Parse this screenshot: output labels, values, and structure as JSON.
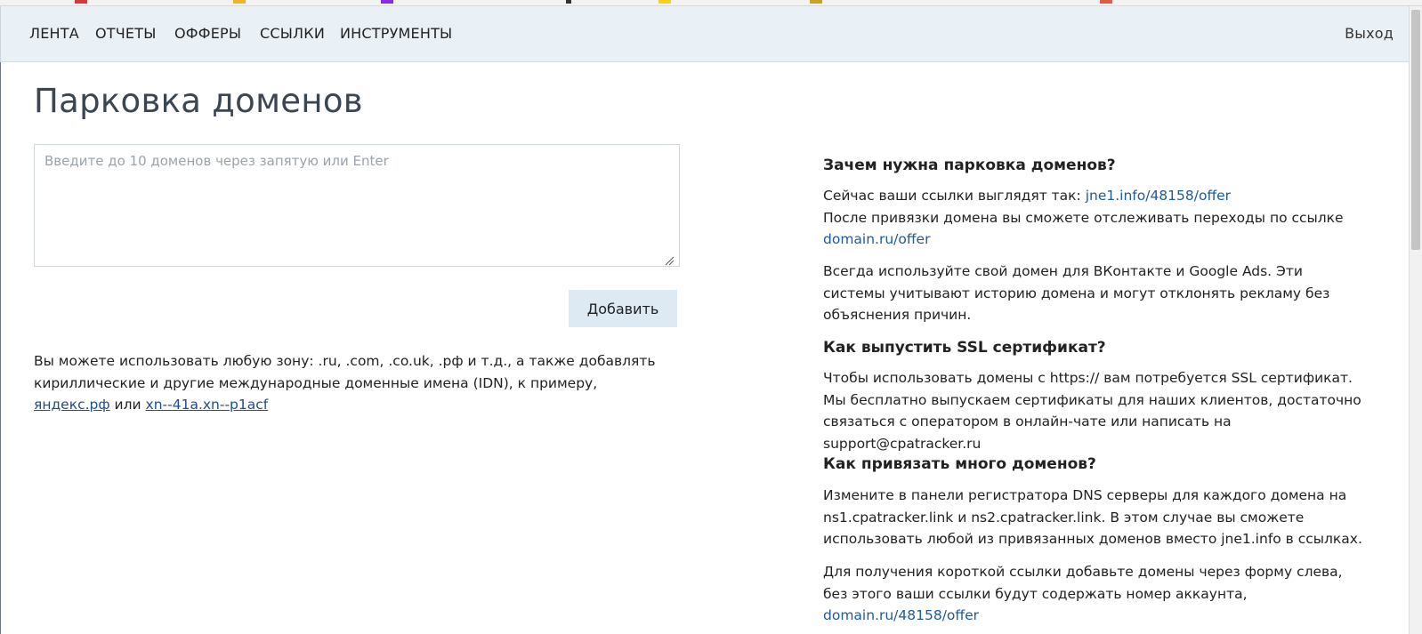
{
  "nav": {
    "items": [
      "ЛЕНТА",
      "ОТЧЕТЫ",
      "ОФФЕРЫ",
      "ССЫЛКИ",
      "ИНСТРУМЕНТЫ"
    ],
    "logout": "Выход"
  },
  "page": {
    "title": "Парковка доменов"
  },
  "form": {
    "placeholder": "Введите до 10 доменов через запятую или Enter",
    "value": "",
    "add_button": "Добавить"
  },
  "note": {
    "text1": "Вы можете использовать любую зону: .ru, .com, .co.uk, .рф и т.д., а также добавлять кириллические и другие международные доменные имена (IDN), к примеру, ",
    "link1": "яндекс.рф",
    "text2": " или ",
    "link2": "xn--41a.xn--p1acf"
  },
  "help": {
    "why": {
      "title": "Зачем нужна парковка доменов?",
      "p1_text": "Сейчас ваши ссылки выглядят так: ",
      "p1_link": "jne1.info/48158/offer",
      "p2_text": "После привязки домена вы сможете отслеживать переходы по ссылке",
      "p2_link": "domain.ru/offer",
      "p3": "Всегда используйте свой домен для ВКонтакте и Google Ads. Эти системы учитывают историю домена и могут отклонять рекламу без объяснения причин."
    },
    "ssl": {
      "title": "Как выпустить SSL сертификат?",
      "p1": "Чтобы использовать домены с https:// вам потребуется SSL сертификат. Мы бесплатно выпускаем сертификаты для наших клиентов, достаточно связаться с оператором в онлайн-чате или написать на support@cpatracker.ru"
    },
    "many": {
      "title": "Как привязать много доменов?",
      "p1": "Измените в панели регистратора DNS серверы для каждого домена на ns1.cpatracker.link и ns2.cpatracker.link. В этом случае вы сможете использовать любой из привязанных доменов вместо jne1.info в ссылках.",
      "p2_text": "Для получения короткой ссылки добавьте домены через форму слева, без этого ваши ссылки будут содержать номер аккаунта, ",
      "p2_link": "domain.ru/48158/offer"
    }
  }
}
